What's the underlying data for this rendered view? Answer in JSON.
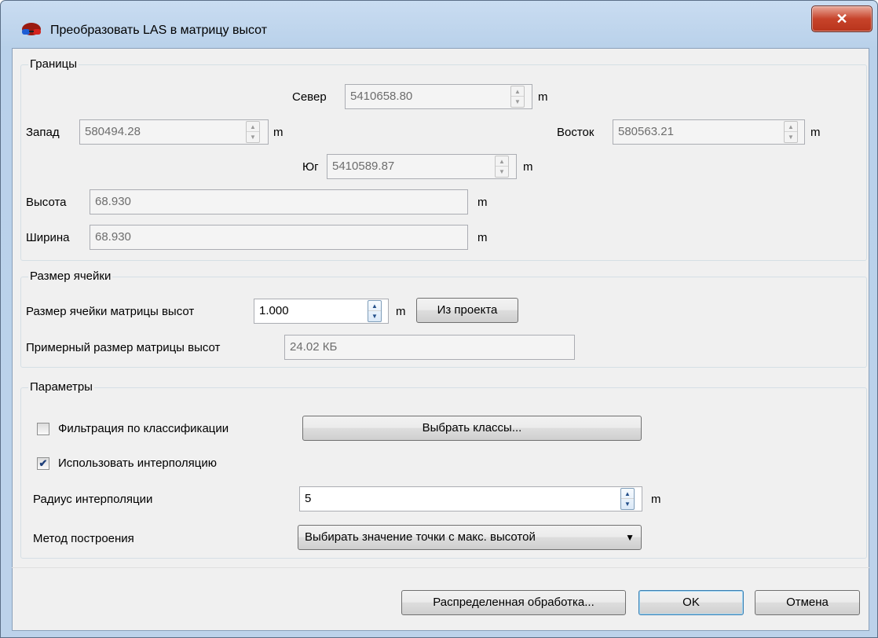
{
  "window": {
    "title": "Преобразовать LAS в матрицу высот",
    "close_glyph": "✕",
    "icon": "stereo-glasses-icon"
  },
  "bounds": {
    "group_title": "Границы",
    "north": {
      "label": "Север",
      "value": "5410658.80",
      "unit": "m"
    },
    "west": {
      "label": "Запад",
      "value": "580494.28",
      "unit": "m"
    },
    "east": {
      "label": "Восток",
      "value": "580563.21",
      "unit": "m"
    },
    "south": {
      "label": "Юг",
      "value": "5410589.87",
      "unit": "m"
    },
    "height": {
      "label": "Высота",
      "value": "68.930",
      "unit": "m"
    },
    "width": {
      "label": "Ширина",
      "value": "68.930",
      "unit": "m"
    }
  },
  "cell": {
    "group_title": "Размер ячейки",
    "cell_size": {
      "label": "Размер ячейки матрицы высот",
      "value": "1.000",
      "unit": "m"
    },
    "from_project_label": "Из проекта",
    "approx_size": {
      "label": "Примерный размер матрицы высот",
      "value": "24.02 КБ"
    }
  },
  "params": {
    "group_title": "Параметры",
    "filter": {
      "label": "Фильтрация по классификации",
      "checked": false
    },
    "select_classes_label": "Выбрать классы...",
    "interpolation": {
      "label": "Использовать интерполяцию",
      "checked": true
    },
    "radius": {
      "label": "Радиус интерполяции",
      "value": "5",
      "unit": "m"
    },
    "method": {
      "label": "Метод построения",
      "selected": "Выбирать значение точки с макс. высотой"
    }
  },
  "footer": {
    "distributed_label": "Распределенная обработка...",
    "ok_label": "OK",
    "cancel_label": "Отмена"
  },
  "glyphs": {
    "spin_up": "▲",
    "spin_down": "▼",
    "check": "✔",
    "dropdown": "▼"
  },
  "colors": {
    "titlebar": "#b9d1ea",
    "close": "#c7432a",
    "dialog_bg": "#f0f0f0"
  }
}
